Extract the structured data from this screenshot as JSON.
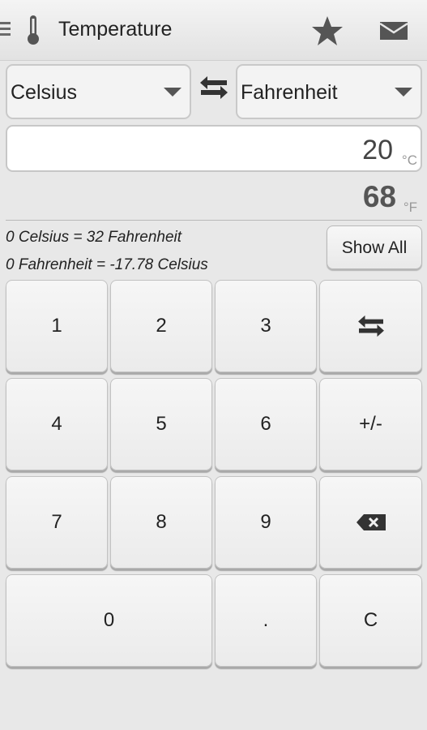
{
  "app": {
    "title": "Temperature",
    "icons": {
      "menu": "hamburger-icon",
      "app": "thermometer-icon",
      "favorite": "star-icon",
      "share": "mail-icon"
    }
  },
  "converter": {
    "from_unit": "Celsius",
    "to_unit": "Fahrenheit",
    "input_value": "20",
    "input_unit": "°C",
    "result_value": "68",
    "result_unit": "°F",
    "formulas": [
      "0 Celsius = 32 Fahrenheit",
      "0 Fahrenheit = -17.78 Celsius"
    ],
    "show_all_label": "Show All"
  },
  "keypad": {
    "k1": "1",
    "k2": "2",
    "k3": "3",
    "k4": "4",
    "k5": "5",
    "k6": "6",
    "sign": "+/-",
    "k7": "7",
    "k8": "8",
    "k9": "9",
    "k0": "0",
    "dot": ".",
    "clear": "C",
    "icons": {
      "swap": "swap-arrows-icon",
      "backspace": "backspace-icon"
    }
  },
  "colors": {
    "background": "#e8e8e8",
    "key": "#efefef",
    "text": "#222222",
    "muted": "#999999"
  }
}
